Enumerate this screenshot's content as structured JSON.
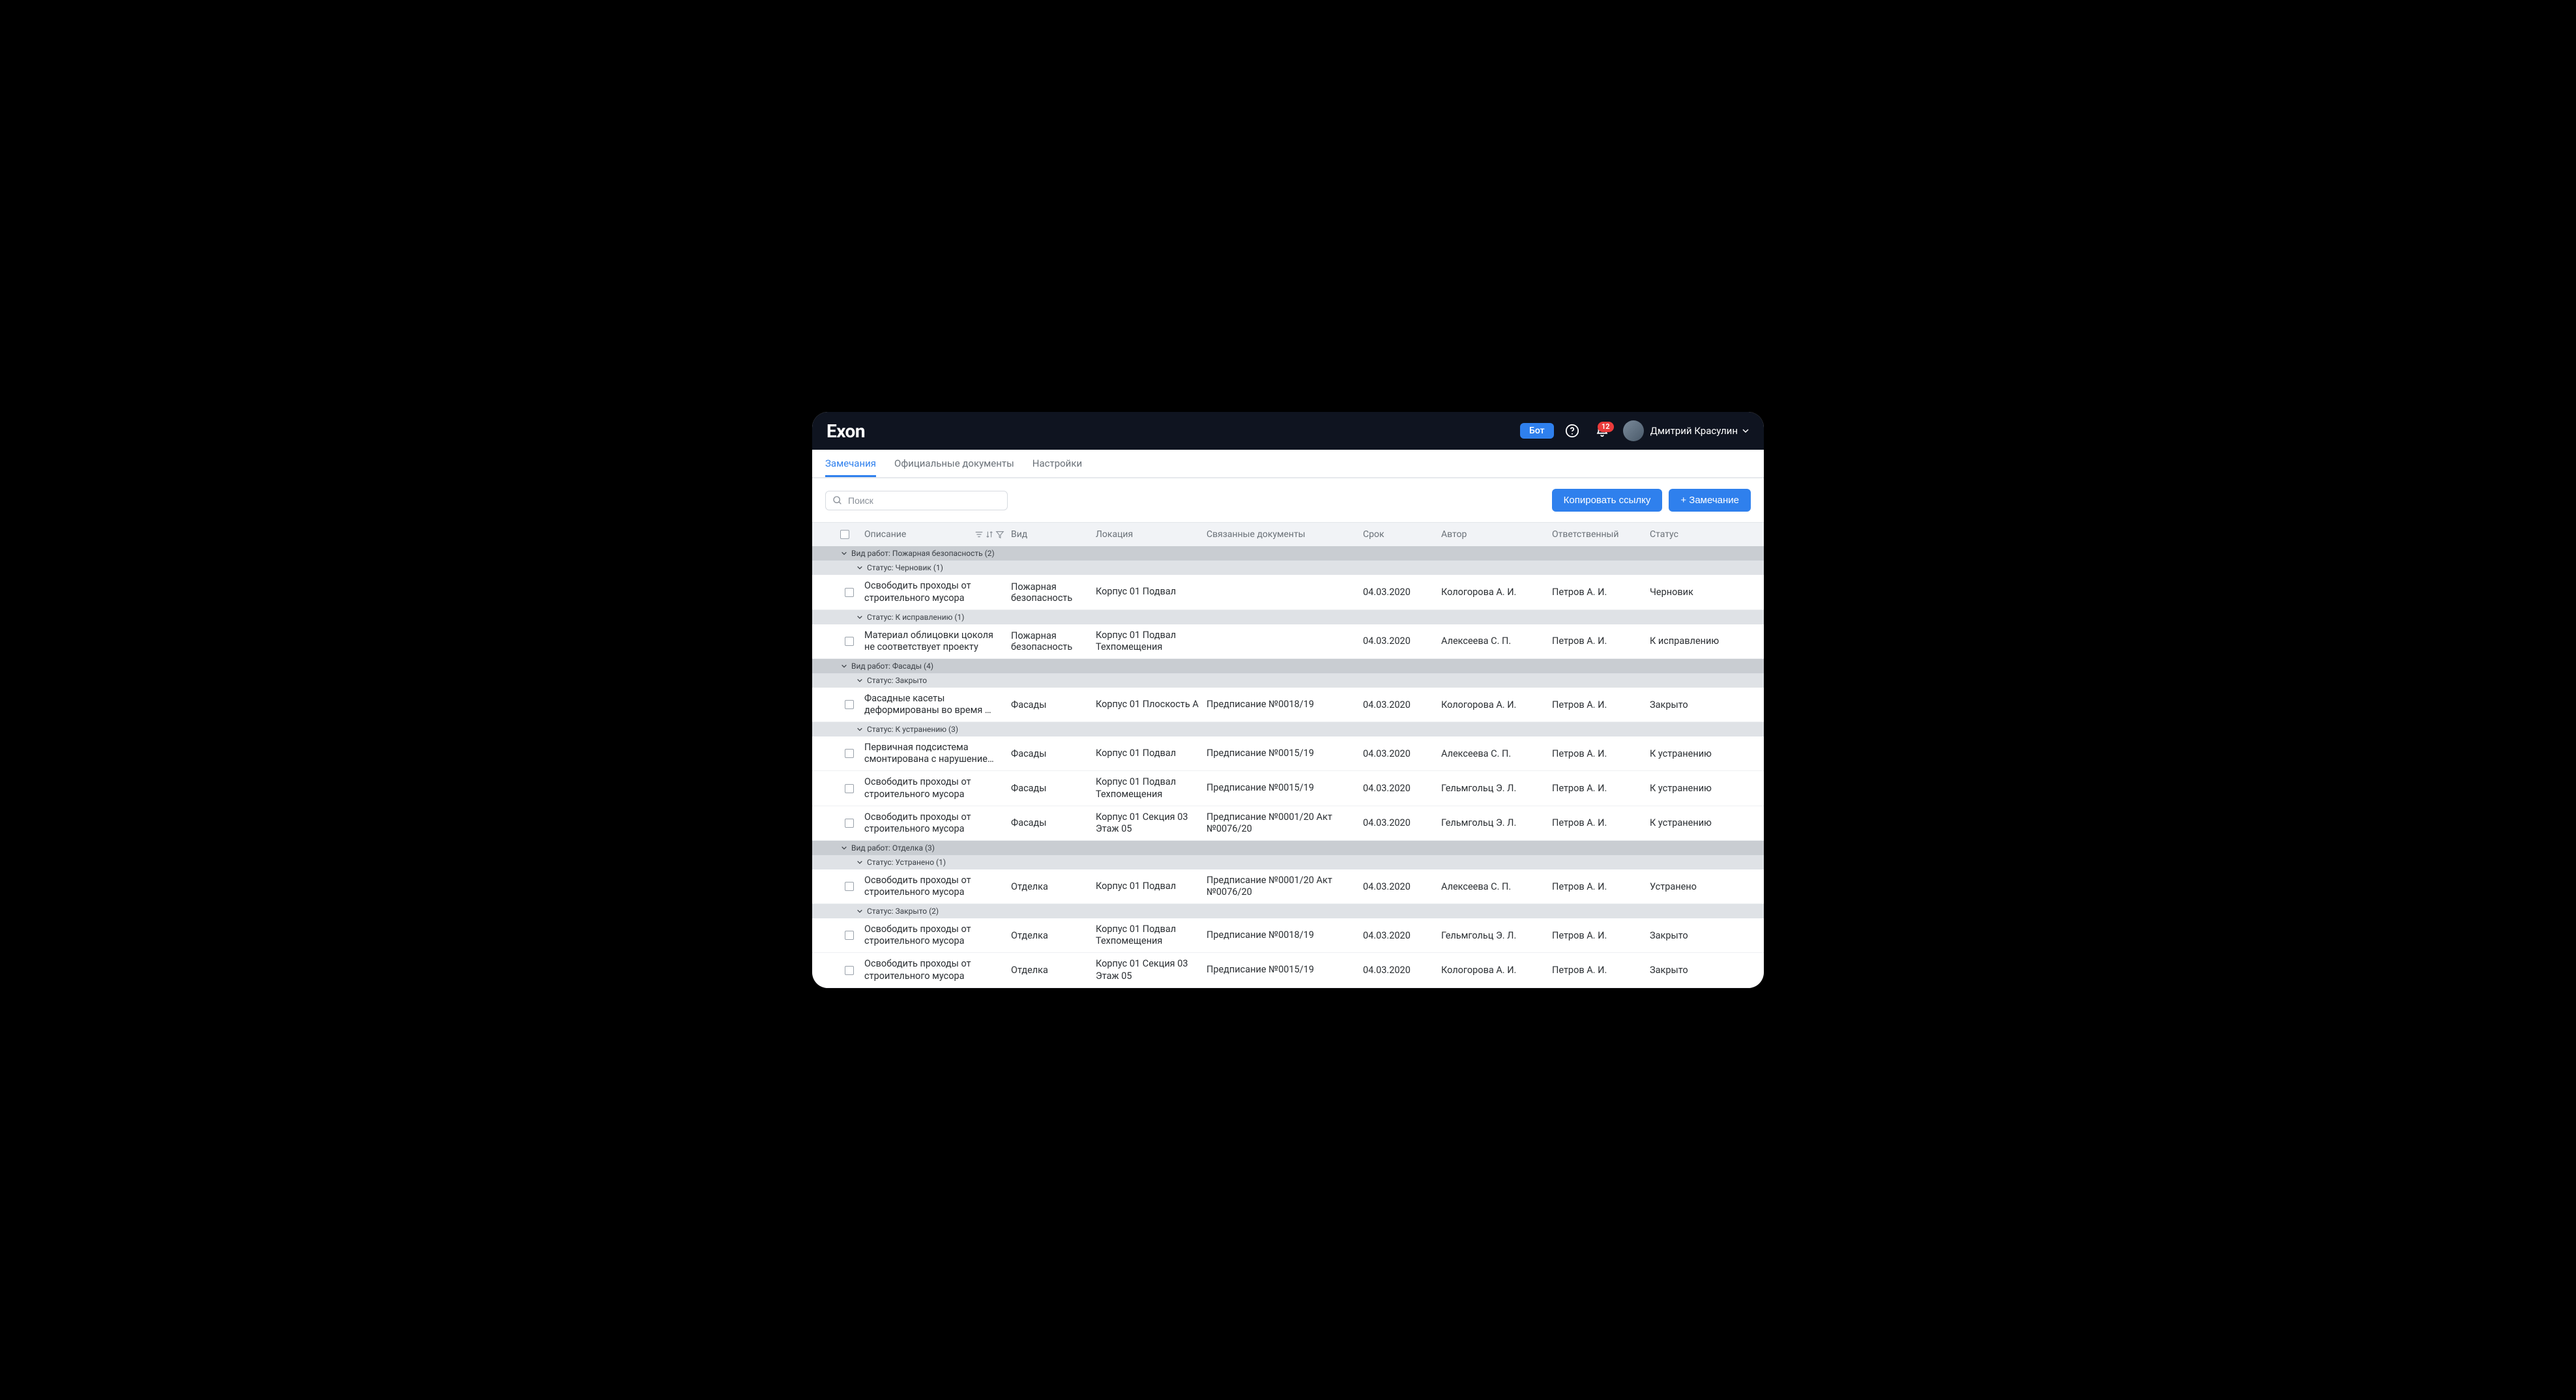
{
  "brand": "Exon",
  "header": {
    "bot": "Бот",
    "notifications": 12,
    "username": "Дмитрий Красулин"
  },
  "tabs": [
    {
      "label": "Замечания",
      "active": true
    },
    {
      "label": "Официальные документы",
      "active": false
    },
    {
      "label": "Настройки",
      "active": false
    }
  ],
  "search_placeholder": "Поиск",
  "buttons": {
    "copy_link": "Копировать ссылку",
    "add_comment": "+ Замечание"
  },
  "columns": {
    "desc": "Описание",
    "type": "Вид",
    "loc": "Локация",
    "docs": "Связанные документы",
    "date": "Срок",
    "auth": "Автор",
    "resp": "Ответственный",
    "stat": "Статус"
  },
  "groups": [
    {
      "label": "Вид работ: Пожарная безопасность (2)",
      "subs": [
        {
          "label": "Статус: Черновик (1)",
          "rows": [
            {
              "desc": "Освободить проходы от строительного мусора",
              "type": "Пожарная безопасность",
              "loc": "Корпус 01 Подвал",
              "docs": "",
              "date": "04.03.2020",
              "auth": "Кологорова А. И.",
              "resp": "Петров А. И.",
              "stat": "Черновик"
            }
          ]
        },
        {
          "label": "Статус: К исправлению (1)",
          "rows": [
            {
              "desc": "Материал облицовки цоколя не соответствует проекту",
              "type": "Пожарная безопасность",
              "loc": "Корпус 01 Подвал Техпомещения",
              "docs": "",
              "date": "04.03.2020",
              "auth": "Алексеева С. П.",
              "resp": "Петров А. И.",
              "stat": "К исправлению"
            }
          ]
        }
      ]
    },
    {
      "label": "Вид работ: Фасады (4)",
      "subs": [
        {
          "label": "Статус: Закрыто",
          "rows": [
            {
              "desc": "Фасадные касеты деформированы во время …",
              "type": "Фасады",
              "loc": "Корпус 01 Плоскость А",
              "docs": "Предписание №0018/19",
              "date": "04.03.2020",
              "auth": "Кологорова А. И.",
              "resp": "Петров А. И.",
              "stat": "Закрыто"
            }
          ]
        },
        {
          "label": "Статус: К устранению (3)",
          "rows": [
            {
              "desc": "Первичная подсистема смонтирована с нарушение…",
              "type": "Фасады",
              "loc": "Корпус 01 Подвал",
              "docs": "Предписание №0015/19",
              "date": "04.03.2020",
              "auth": "Алексеева С. П.",
              "resp": "Петров А. И.",
              "stat": "К устранению"
            },
            {
              "desc": "Освободить проходы от строительного мусора",
              "type": "Фасады",
              "loc": "Корпус 01 Подвал Техпомещения",
              "docs": "Предписание №0015/19",
              "date": "04.03.2020",
              "auth": "Гельмгольц Э. Л.",
              "resp": "Петров А. И.",
              "stat": "К устранению"
            },
            {
              "desc": "Освободить проходы от строительного мусора",
              "type": "Фасады",
              "loc": "Корпус 01 Секция 03 Этаж 05",
              "docs": "Предписание №0001/20 Акт №0076/20",
              "date": "04.03.2020",
              "auth": "Гельмгольц Э. Л.",
              "resp": "Петров А. И.",
              "stat": "К устранению"
            }
          ]
        }
      ]
    },
    {
      "label": "Вид работ: Отделка (3)",
      "subs": [
        {
          "label": "Статус: Устранено (1)",
          "rows": [
            {
              "desc": "Освободить проходы от строительного мусора",
              "type": "Отделка",
              "loc": "Корпус 01 Подвал",
              "docs": "Предписание №0001/20 Акт №0076/20",
              "date": "04.03.2020",
              "auth": "Алексеева С. П.",
              "resp": "Петров А. И.",
              "stat": "Устранено"
            }
          ]
        },
        {
          "label": "Статус: Закрыто (2)",
          "rows": [
            {
              "desc": "Освободить проходы от строительного мусора",
              "type": "Отделка",
              "loc": "Корпус 01 Подвал Техпомещения",
              "docs": "Предписание №0018/19",
              "date": "04.03.2020",
              "auth": "Гельмгольц Э. Л.",
              "resp": "Петров А. И.",
              "stat": "Закрыто"
            },
            {
              "desc": "Освободить проходы от строительного мусора",
              "type": "Отделка",
              "loc": "Корпус 01 Секция 03 Этаж 05",
              "docs": "Предписание №0015/19",
              "date": "04.03.2020",
              "auth": "Кологорова А. И.",
              "resp": "Петров А. И.",
              "stat": "Закрыто"
            }
          ]
        }
      ]
    }
  ]
}
